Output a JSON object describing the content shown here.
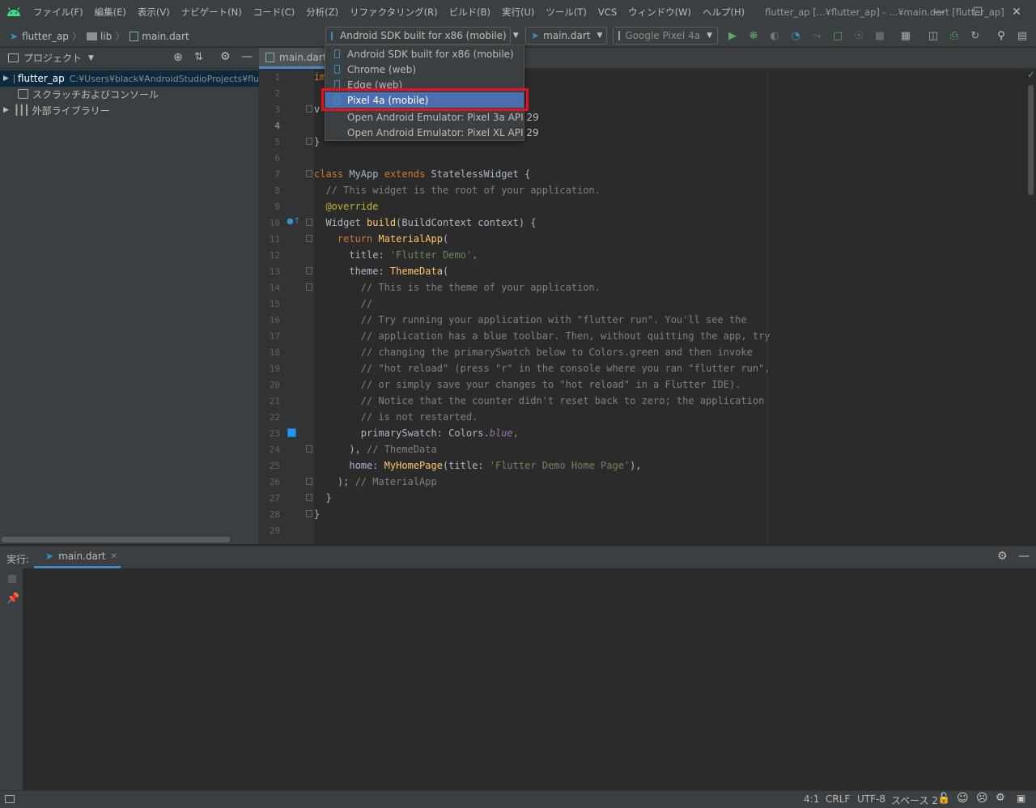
{
  "menubar": {
    "items": [
      "ファイル(F)",
      "編集(E)",
      "表示(V)",
      "ナビゲート(N)",
      "コード(C)",
      "分析(Z)",
      "リファクタリング(R)",
      "ビルド(B)",
      "実行(U)",
      "ツール(T)",
      "VCS",
      "ウィンドウ(W)",
      "ヘルプ(H)"
    ],
    "window_title": "flutter_ap [...¥flutter_ap] - ...¥main.dart [flutter_ap]"
  },
  "breadcrumb": {
    "project": "flutter_ap",
    "folder": "lib",
    "file": "main.dart"
  },
  "toolbar": {
    "device_target": "Android SDK built for x86 (mobile)",
    "run_config": "main.dart",
    "device_selector": "Google Pixel 4a"
  },
  "device_dropdown": {
    "items": [
      {
        "label": "Android SDK built for x86 (mobile)",
        "icon": "phone-icon",
        "selected": false
      },
      {
        "label": "Chrome (web)",
        "icon": "phone-icon",
        "selected": false
      },
      {
        "label": "Edge (web)",
        "icon": "phone-icon",
        "selected": false
      },
      {
        "label": "Pixel 4a (mobile)",
        "icon": "phone-icon",
        "selected": true
      },
      {
        "label": "Open Android Emulator: Pixel 3a API 29",
        "icon": "",
        "selected": false
      },
      {
        "label": "Open Android Emulator: Pixel XL API 29",
        "icon": "",
        "selected": false
      }
    ]
  },
  "project_panel": {
    "title": "プロジェクト",
    "tree": [
      {
        "label": "flutter_ap",
        "path": "C:¥Users¥black¥AndroidStudioProjects¥flu",
        "icon": "folder-icon"
      },
      {
        "label": "スクラッチおよびコンソール",
        "icon": "scratch-icon"
      },
      {
        "label": "外部ライブラリー",
        "icon": "library-icon"
      }
    ]
  },
  "editor": {
    "tab_label": "main.dart",
    "current_line": 4,
    "line_numbers": [
      "1",
      "2",
      "3",
      "4",
      "5",
      "6",
      "7",
      "8",
      "9",
      "10",
      "11",
      "12",
      "13",
      "14",
      "15",
      "16",
      "17",
      "18",
      "19",
      "20",
      "21",
      "22",
      "23",
      "24",
      "25",
      "26",
      "27",
      "28",
      "29"
    ],
    "code": {
      "l1a": "im",
      "l1b": "';",
      "l3": "v",
      "l5": "}",
      "l7_kw": "class ",
      "l7_name": "MyApp ",
      "l7_ext": "extends ",
      "l7_rest": "StatelessWidget {",
      "l8": "  // This widget is the root of your application.",
      "l9": "  @override",
      "l10_a": "  Widget ",
      "l10_fn": "build",
      "l10_b": "(BuildContext context) {",
      "l11_a": "    ",
      "l11_kw": "return ",
      "l11_fn": "MaterialApp",
      "l11_b": "(",
      "l12_a": "      title: ",
      "l12_str": "'Flutter Demo'",
      "l12_b": ",",
      "l13_a": "      theme: ",
      "l13_fn": "ThemeData",
      "l13_b": "(",
      "l14": "        // This is the theme of your application.",
      "l15": "        //",
      "l16": "        // Try running your application with \"flutter run\". You'll see the",
      "l17": "        // application has a blue toolbar. Then, without quitting the app, try",
      "l18": "        // changing the primarySwatch below to Colors.green and then invoke",
      "l19": "        // \"hot reload\" (press \"r\" in the console where you ran \"flutter run\",",
      "l20": "        // or simply save your changes to \"hot reload\" in a Flutter IDE).",
      "l21": "        // Notice that the counter didn't reset back to zero; the application",
      "l22": "        // is not restarted.",
      "l23_a": "        primarySwatch: Colors.",
      "l23_it": "blue",
      "l23_b": ",",
      "l24_a": "      ), ",
      "l24_cm": "// ThemeData",
      "l25_a": "      home: ",
      "l25_fn": "MyHomePage",
      "l25_b": "(title: ",
      "l25_str": "'Flutter Demo Home Page'",
      "l25_c": "),",
      "l26_a": "    ); ",
      "l26_cm": "// MaterialApp",
      "l27": "  }",
      "l28": "}"
    }
  },
  "run_panel": {
    "label": "実行:",
    "tab": "main.dart"
  },
  "statusbar": {
    "position": "4:1",
    "line_sep": "CRLF",
    "encoding": "UTF-8",
    "indent": "スペース 2"
  },
  "colors": {
    "accent": "#4b6eaf",
    "highlight_box": "#e81123",
    "run_green": "#59a869",
    "flutter_blue": "#3592c4"
  }
}
